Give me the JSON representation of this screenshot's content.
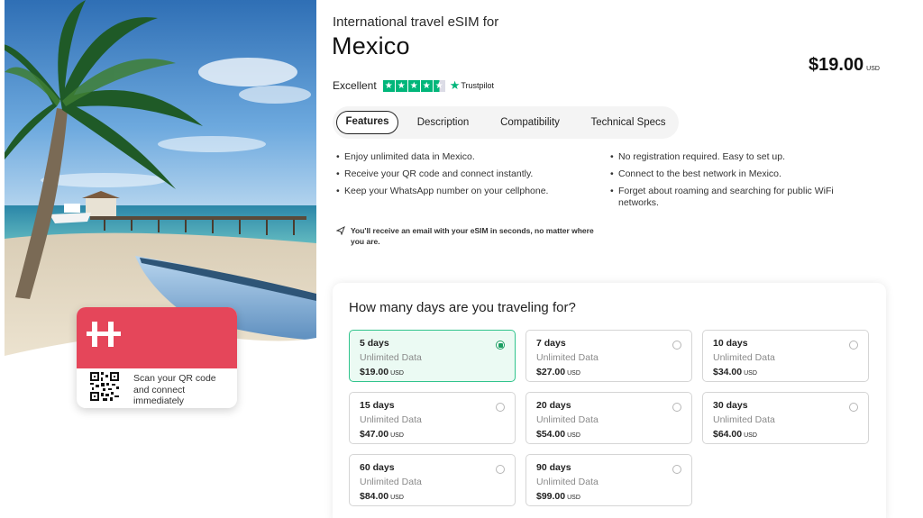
{
  "header": {
    "pretitle": "International travel eSIM for",
    "title": "Mexico",
    "price_amount": "$19.00",
    "price_currency": "USD"
  },
  "rating": {
    "label": "Excellent",
    "stars": 4.5,
    "provider": "Trustpilot",
    "accent_color": "#00b67a"
  },
  "tabs": [
    {
      "label": "Features",
      "active": true
    },
    {
      "label": "Description",
      "active": false
    },
    {
      "label": "Compatibility",
      "active": false
    },
    {
      "label": "Technical Specs",
      "active": false
    }
  ],
  "features": {
    "left": [
      "Enjoy unlimited data in Mexico.",
      "Receive your QR code and connect instantly.",
      "Keep your WhatsApp number on your cellphone."
    ],
    "right": [
      "No registration required. Easy to set up.",
      "Connect to the best network in Mexico.",
      "Forget about roaming and searching for public WiFi networks."
    ]
  },
  "note": {
    "icon": "send-icon",
    "text": "You'll receive an email with your eSIM in seconds, no matter where you are."
  },
  "promo_card": {
    "text": "Scan your QR code and connect immediately",
    "brand_color": "#e5465a",
    "logo_icon": "holafly-h-logo",
    "qr_icon": "qr-code-icon"
  },
  "plans": {
    "title": "How many days are you traveling for?",
    "selected_color": "#31c48d",
    "items": [
      {
        "days": "5 days",
        "data": "Unlimited Data",
        "price": "$19.00",
        "currency": "USD",
        "selected": true
      },
      {
        "days": "7 days",
        "data": "Unlimited Data",
        "price": "$27.00",
        "currency": "USD",
        "selected": false
      },
      {
        "days": "10 days",
        "data": "Unlimited Data",
        "price": "$34.00",
        "currency": "USD",
        "selected": false
      },
      {
        "days": "15 days",
        "data": "Unlimited Data",
        "price": "$47.00",
        "currency": "USD",
        "selected": false
      },
      {
        "days": "20 days",
        "data": "Unlimited Data",
        "price": "$54.00",
        "currency": "USD",
        "selected": false
      },
      {
        "days": "30 days",
        "data": "Unlimited Data",
        "price": "$64.00",
        "currency": "USD",
        "selected": false
      },
      {
        "days": "60 days",
        "data": "Unlimited Data",
        "price": "$84.00",
        "currency": "USD",
        "selected": false
      },
      {
        "days": "90 days",
        "data": "Unlimited Data",
        "price": "$99.00",
        "currency": "USD",
        "selected": false
      }
    ]
  }
}
